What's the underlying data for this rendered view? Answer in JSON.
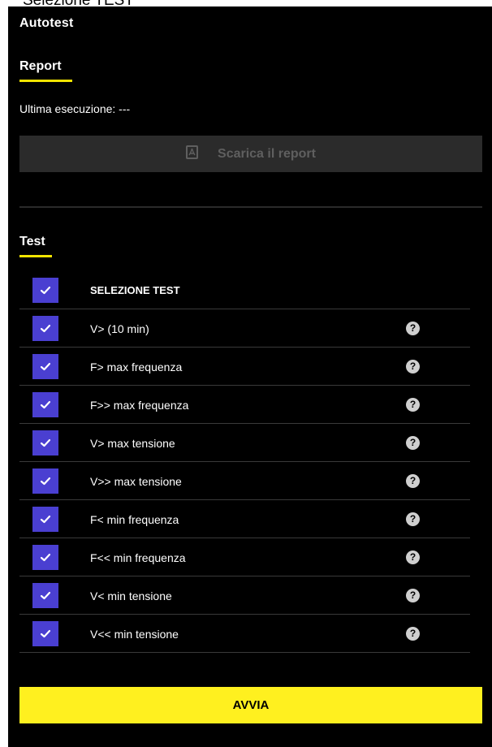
{
  "caption": "Selezione TEST",
  "app": {
    "title": "Autotest"
  },
  "report": {
    "title": "Report",
    "last_run": "Ultima esecuzione: ---",
    "download_label": "Scarica il report"
  },
  "test": {
    "title": "Test",
    "select_all": {
      "label": "SELEZIONE TEST",
      "checked": true
    },
    "items": [
      {
        "label": "V> (10 min)",
        "checked": true
      },
      {
        "label": "F> max frequenza",
        "checked": true
      },
      {
        "label": "F>> max frequenza",
        "checked": true
      },
      {
        "label": "V> max tensione",
        "checked": true
      },
      {
        "label": "V>> max tensione",
        "checked": true
      },
      {
        "label": "F< min frequenza",
        "checked": true
      },
      {
        "label": "F<< min frequenza",
        "checked": true
      },
      {
        "label": "V< min tensione",
        "checked": true
      },
      {
        "label": "V<< min tensione",
        "checked": true
      }
    ],
    "help_glyph": "?"
  },
  "actions": {
    "start_label": "AVVIA"
  },
  "colors": {
    "accent": "#f2e400",
    "checkbox": "#4a3fd1",
    "start_button": "#fff01f",
    "disabled_button": "#2b2b2b"
  },
  "icons": {
    "download": "pdf-file-icon",
    "check": "check-icon",
    "help": "help-circle-icon"
  }
}
